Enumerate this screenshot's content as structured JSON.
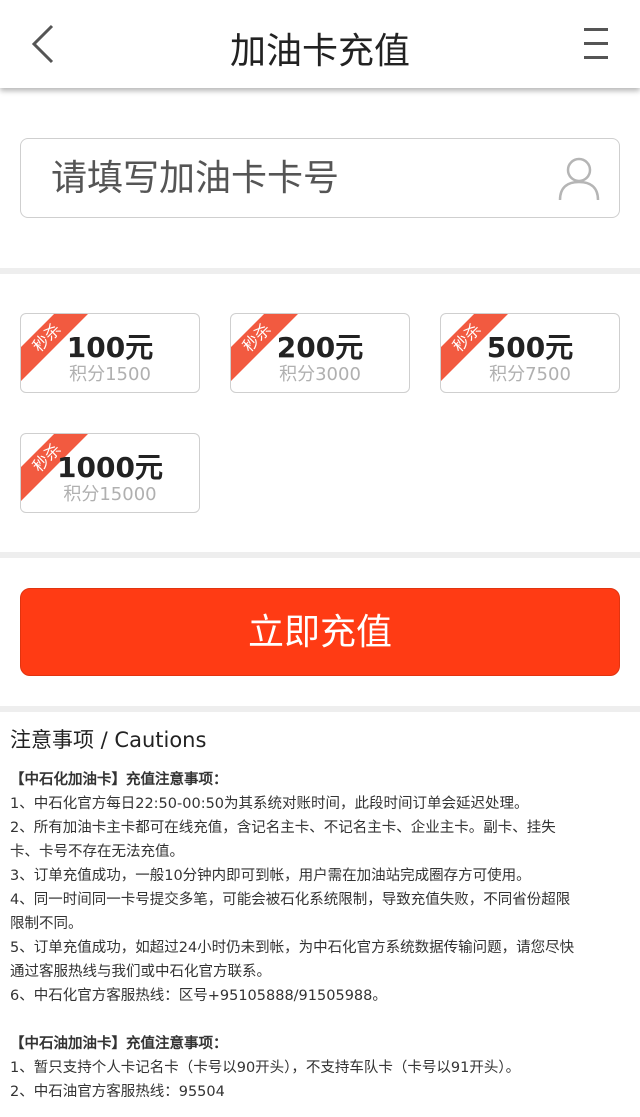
{
  "header": {
    "title": "加油卡充值",
    "back_icon": "chevron-left-icon",
    "menu_icon": "hamburger-menu-icon"
  },
  "card_input": {
    "placeholder": "请填写加油卡卡号",
    "value": "",
    "icon": "user-icon"
  },
  "amounts": [
    {
      "badge": "秒杀",
      "price": "100元",
      "points": "积分1500"
    },
    {
      "badge": "秒杀",
      "price": "200元",
      "points": "积分3000"
    },
    {
      "badge": "秒杀",
      "price": "500元",
      "points": "积分7500"
    },
    {
      "badge": "秒杀",
      "price": "1000元",
      "points": "积分15000"
    }
  ],
  "submit": {
    "label": "立即充值"
  },
  "notes": {
    "title": "注意事项 / Cautions",
    "sinopec": {
      "heading": "【中石化加油卡】充值注意事项：",
      "lines": [
        "1、中石化官方每日22:50-00:50为其系统对账时间，此段时间订单会延迟处理。",
        "2、所有加油卡主卡都可在线充值，含记名主卡、不记名主卡、企业主卡。副卡、挂失",
        "卡、卡号不存在无法充值。",
        "3、订单充值成功，一般10分钟内即可到帐，用户需在加油站完成圈存方可使用。",
        "4、同一时间同一卡号提交多笔，可能会被石化系统限制，导致充值失败，不同省份超限",
        "限制不同。",
        "5、订单充值成功，如超过24小时仍未到帐，为中石化官方系统数据传输问题，请您尽快",
        "通过客服热线与我们或中石化官方联系。",
        "6、中石化官方客服热线：区号+95105888/91505988。"
      ]
    },
    "petrochina": {
      "heading": "【中石油加油卡】充值注意事项：",
      "lines": [
        "1、暂只支持个人卡记名卡（卡号以90开头），不支持车队卡（卡号以91开头）。",
        "2、中石油官方客服热线：95504"
      ]
    }
  },
  "colors": {
    "accent": "#ff3b14",
    "ribbon": "#f25a40",
    "border": "#cfcfcf",
    "points_text": "#b0b0b0"
  }
}
